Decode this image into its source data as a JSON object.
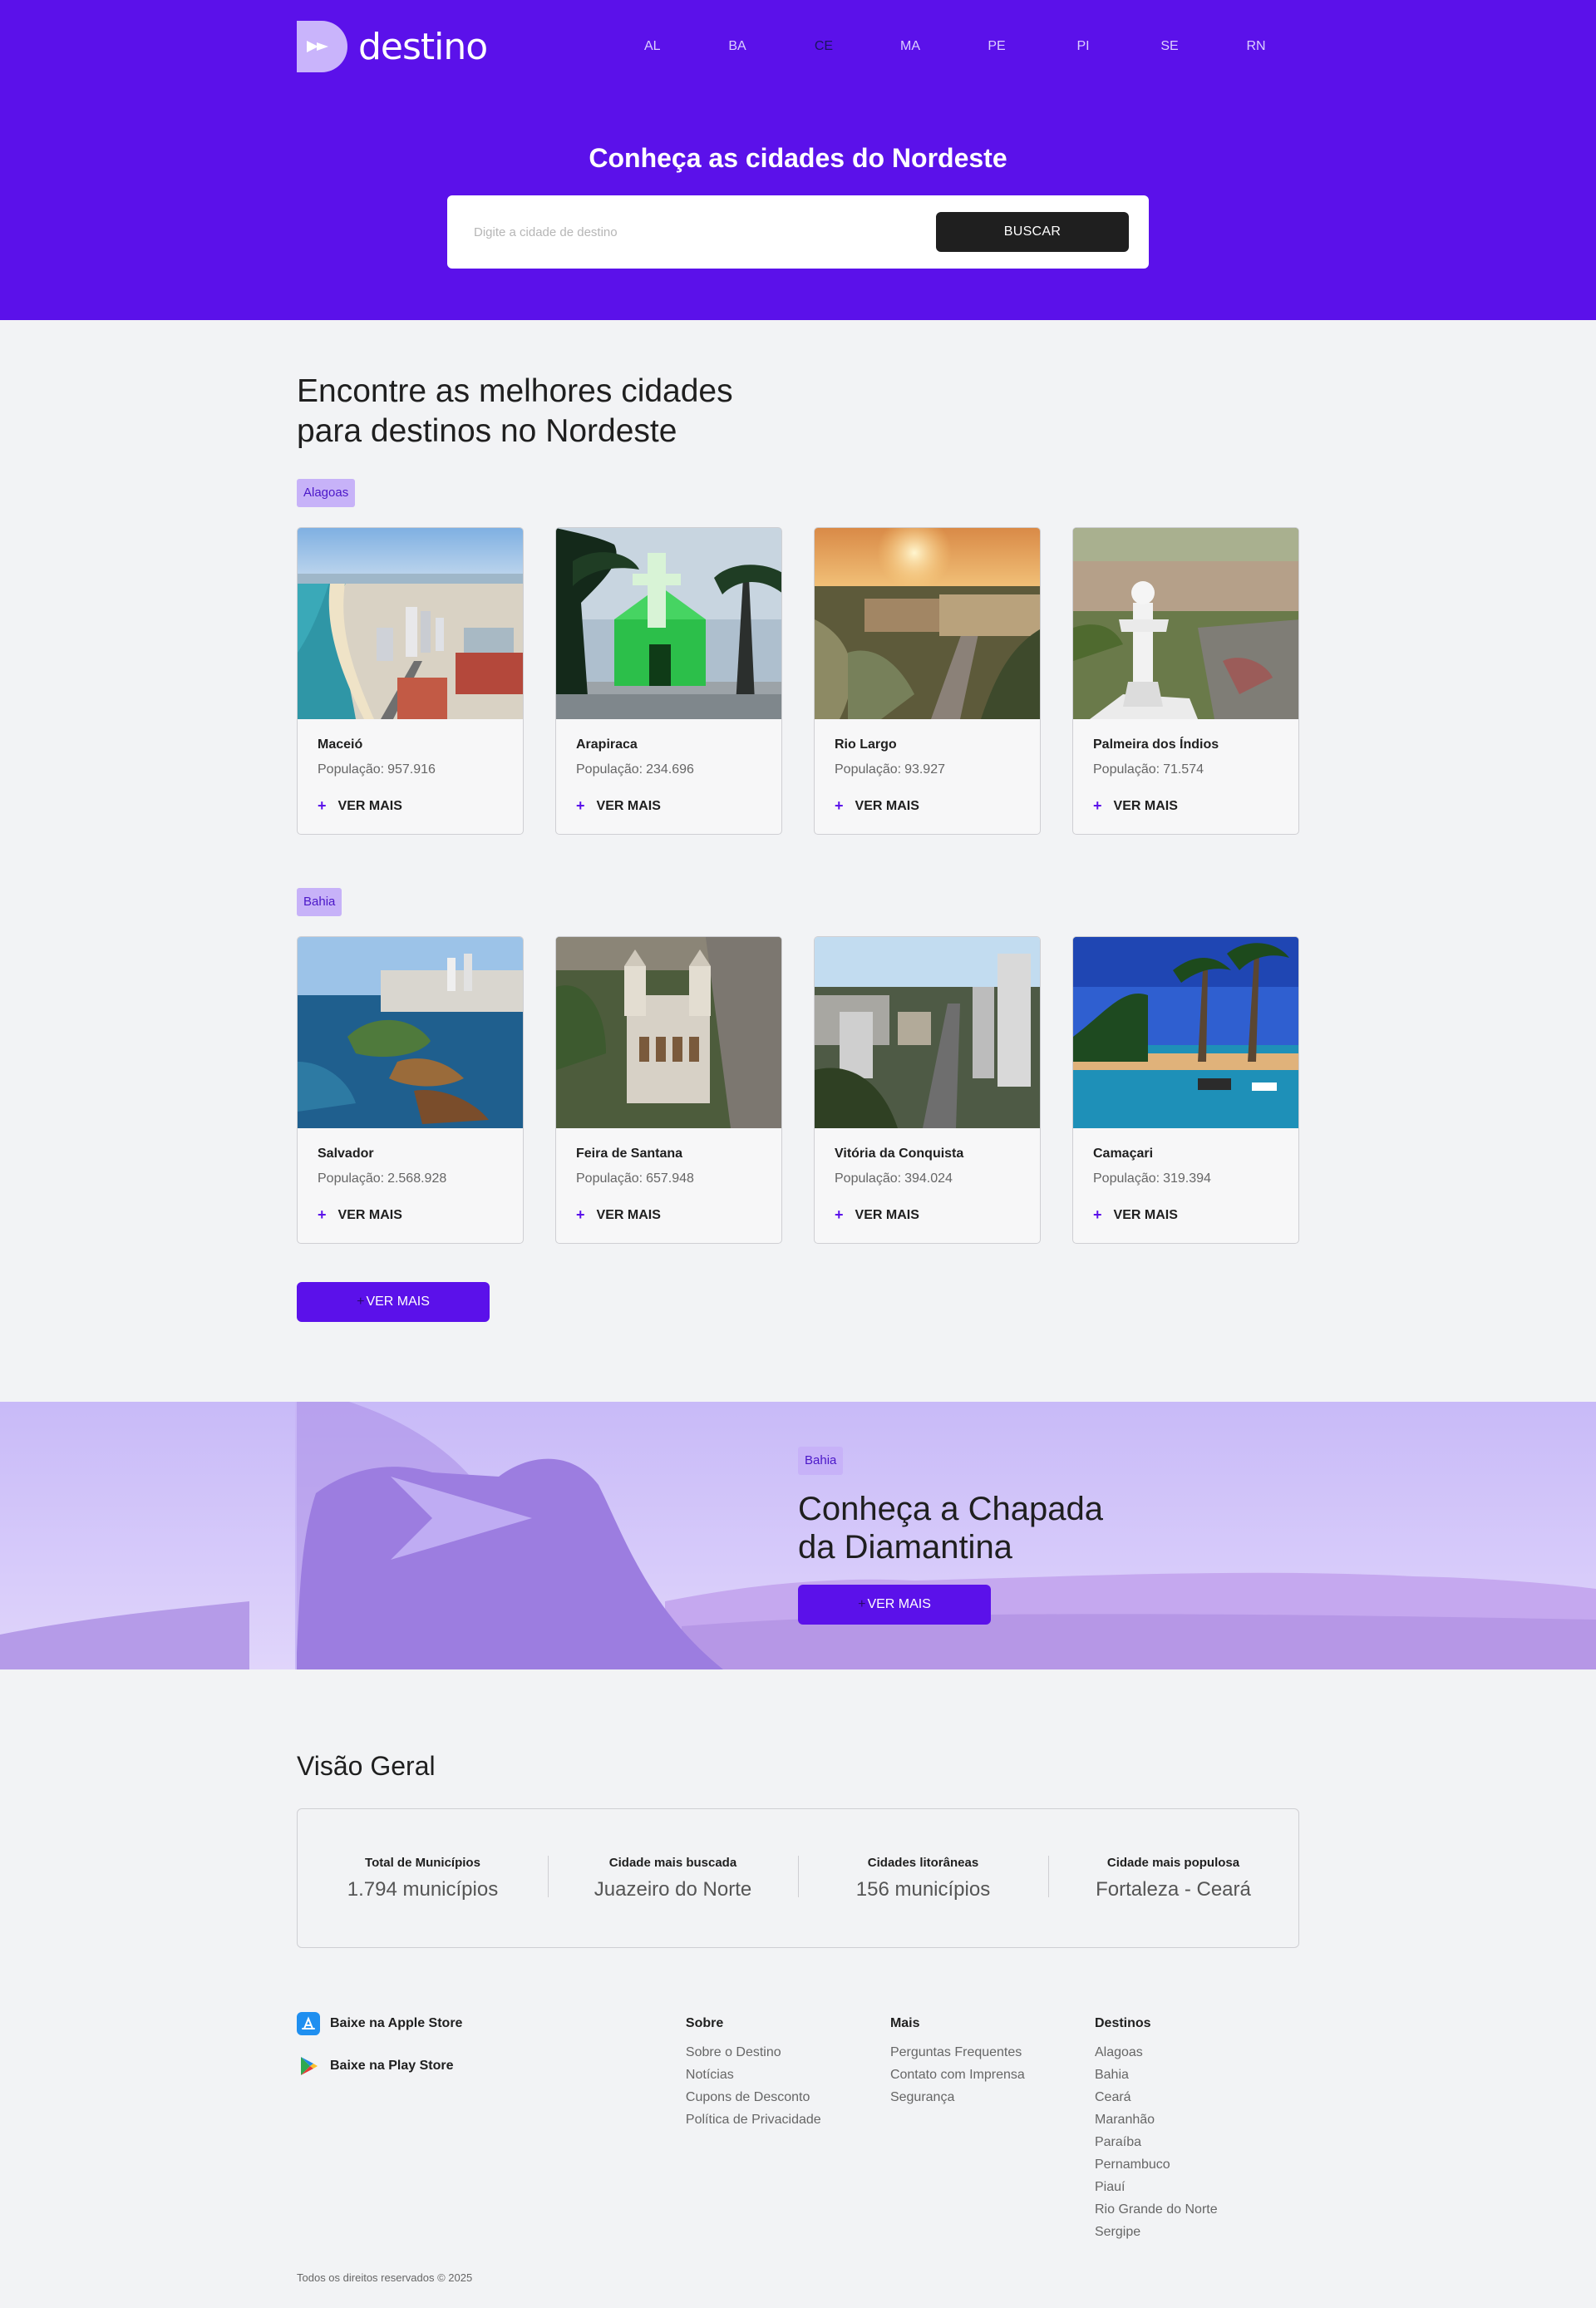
{
  "brand": {
    "name": "destino"
  },
  "nav": {
    "items": [
      "AL",
      "BA",
      "CE",
      "MA",
      "PE",
      "PI",
      "SE",
      "RN"
    ],
    "active": "CE"
  },
  "hero": {
    "title": "Conheça as cidades do Nordeste",
    "search_placeholder": "Digite a cidade de destino",
    "search_button": "BUSCAR"
  },
  "main": {
    "title_line1": "Encontre as melhores cidades",
    "title_line2": "para destinos no Nordeste",
    "see_more": "VER MAIS",
    "groups": [
      {
        "state": "Alagoas",
        "cities": [
          {
            "name": "Maceió",
            "pop_label": "População:",
            "pop": "957.916",
            "more": "VER MAIS"
          },
          {
            "name": "Arapiraca",
            "pop_label": "População:",
            "pop": "234.696",
            "more": "VER MAIS"
          },
          {
            "name": "Rio Largo",
            "pop_label": "População:",
            "pop": "93.927",
            "more": "VER MAIS"
          },
          {
            "name": "Palmeira dos Índios",
            "pop_label": "População:",
            "pop": "71.574",
            "more": "VER MAIS"
          }
        ]
      },
      {
        "state": "Bahia",
        "cities": [
          {
            "name": "Salvador",
            "pop_label": "População:",
            "pop": "2.568.928",
            "more": "VER MAIS"
          },
          {
            "name": "Feira de Santana",
            "pop_label": "População:",
            "pop": "657.948",
            "more": "VER MAIS"
          },
          {
            "name": "Vitória da Conquista",
            "pop_label": "População:",
            "pop": "394.024",
            "more": "VER MAIS"
          },
          {
            "name": "Camaçari",
            "pop_label": "População:",
            "pop": "319.394",
            "more": "VER MAIS"
          }
        ]
      }
    ]
  },
  "banner": {
    "tag": "Bahia",
    "title_line1": "Conheça a Chapada",
    "title_line2": "da Diamantina",
    "button": "VER MAIS"
  },
  "overview": {
    "title": "Visão Geral",
    "items": [
      {
        "label": "Total de Municípios",
        "value": "1.794 municípios"
      },
      {
        "label": "Cidade mais buscada",
        "value": "Juazeiro do Norte"
      },
      {
        "label": "Cidades litorâneas",
        "value": "156 municípios"
      },
      {
        "label": "Cidade mais populosa",
        "value": "Fortaleza - Ceará"
      }
    ]
  },
  "footer": {
    "apple": "Baixe na Apple Store",
    "play": "Baixe na Play Store",
    "columns": [
      {
        "title": "Sobre",
        "links": [
          "Sobre o Destino",
          "Notícias",
          "Cupons de Desconto",
          "Política de Privacidade"
        ]
      },
      {
        "title": "Mais",
        "links": [
          "Perguntas Frequentes",
          "Contato com Imprensa",
          "Segurança"
        ]
      },
      {
        "title": "Destinos",
        "links": [
          "Alagoas",
          "Bahia",
          "Ceará",
          "Maranhão",
          "Paraíba",
          "Pernambuco",
          "Piauí",
          "Rio Grande do Norte",
          "Sergipe"
        ]
      }
    ],
    "copyright": "Todos os direitos reservados © 2025"
  },
  "colors": {
    "primary": "#5b11ea",
    "dark": "#1f1f1f",
    "tag_bg": "#c7b2f8",
    "page_bg": "#f2f3f5"
  }
}
